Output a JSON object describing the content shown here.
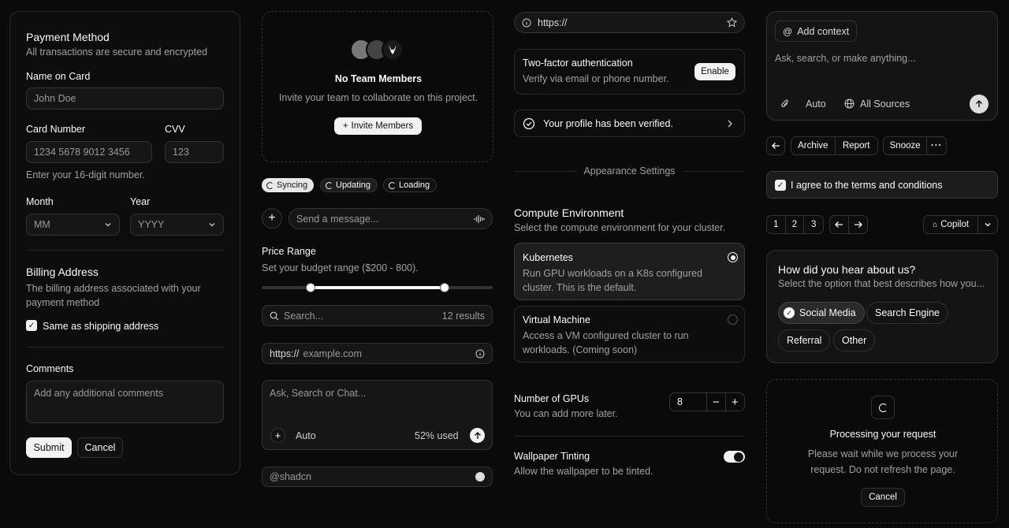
{
  "payment": {
    "title": "Payment Method",
    "subtitle": "All transactions are secure and encrypted",
    "name_label": "Name on Card",
    "name_placeholder": "John Doe",
    "card_label": "Card Number",
    "card_placeholder": "1234 5678 9012 3456",
    "cvv_label": "CVV",
    "cvv_placeholder": "123",
    "card_help": "Enter your 16-digit number.",
    "month_label": "Month",
    "month_value": "MM",
    "year_label": "Year",
    "year_value": "YYYY",
    "billing_title": "Billing Address",
    "billing_desc": "The billing address associated with your payment method",
    "same_address_label": "Same as shipping address",
    "same_address_checked": true,
    "comments_label": "Comments",
    "comments_placeholder": "Add any additional comments",
    "submit_label": "Submit",
    "cancel_label": "Cancel"
  },
  "team": {
    "title": "No Team Members",
    "desc": "Invite your team to collaborate on this project.",
    "invite_label": "Invite Members"
  },
  "status_pills": [
    {
      "label": "Syncing",
      "active": true
    },
    {
      "label": "Updating",
      "active": false
    },
    {
      "label": "Loading",
      "active": false
    }
  ],
  "message": {
    "placeholder": "Send a message..."
  },
  "price": {
    "title": "Price Range",
    "desc": "Set your budget range ($200 - 800).",
    "min_fraction": 0.2,
    "max_fraction": 0.8
  },
  "search": {
    "placeholder": "Search...",
    "results": "12 results"
  },
  "url_input": {
    "prefix": "https://",
    "placeholder": "example.com"
  },
  "chat": {
    "placeholder": "Ask, Search or Chat...",
    "mode": "Auto",
    "usage": "52% used"
  },
  "username": {
    "placeholder": "@shadcn"
  },
  "browser": {
    "url": "https://"
  },
  "twofa": {
    "title": "Two-factor authentication",
    "desc": "Verify via email or phone number.",
    "enable_label": "Enable"
  },
  "verified": {
    "text": "Your profile has been verified."
  },
  "appearance": {
    "heading": "Appearance Settings"
  },
  "compute": {
    "title": "Compute Environment",
    "desc": "Select the compute environment for your cluster.",
    "options": [
      {
        "title": "Kubernetes",
        "desc": "Run GPU workloads on a K8s configured cluster. This is the default.",
        "selected": true
      },
      {
        "title": "Virtual Machine",
        "desc": "Access a VM configured cluster to run workloads. (Coming soon)",
        "selected": false
      }
    ]
  },
  "gpus": {
    "title": "Number of GPUs",
    "desc": "You can add more later.",
    "value": "8"
  },
  "wallpaper": {
    "title": "Wallpaper Tinting",
    "desc": "Allow the wallpaper to be tinted.",
    "enabled": true
  },
  "assistant": {
    "context_label": "Add context",
    "placeholder": "Ask, search, or make anything...",
    "mode": "Auto",
    "sources": "All Sources"
  },
  "mail_actions": {
    "archive": "Archive",
    "report": "Report",
    "snooze": "Snooze"
  },
  "terms": {
    "label": "I agree to the terms and conditions",
    "checked": true
  },
  "pagination": {
    "pages": [
      "1",
      "2",
      "3"
    ]
  },
  "copilot": {
    "label": "Copilot"
  },
  "survey": {
    "title": "How did you hear about us?",
    "desc": "Select the option that best describes how you...",
    "options": [
      {
        "label": "Social Media",
        "selected": true
      },
      {
        "label": "Search Engine",
        "selected": false
      },
      {
        "label": "Referral",
        "selected": false
      },
      {
        "label": "Other",
        "selected": false
      }
    ]
  },
  "processing": {
    "title": "Processing your request",
    "desc_line1": "Please wait while we process your",
    "desc_line2": "request. Do not refresh the page.",
    "cancel_label": "Cancel"
  }
}
